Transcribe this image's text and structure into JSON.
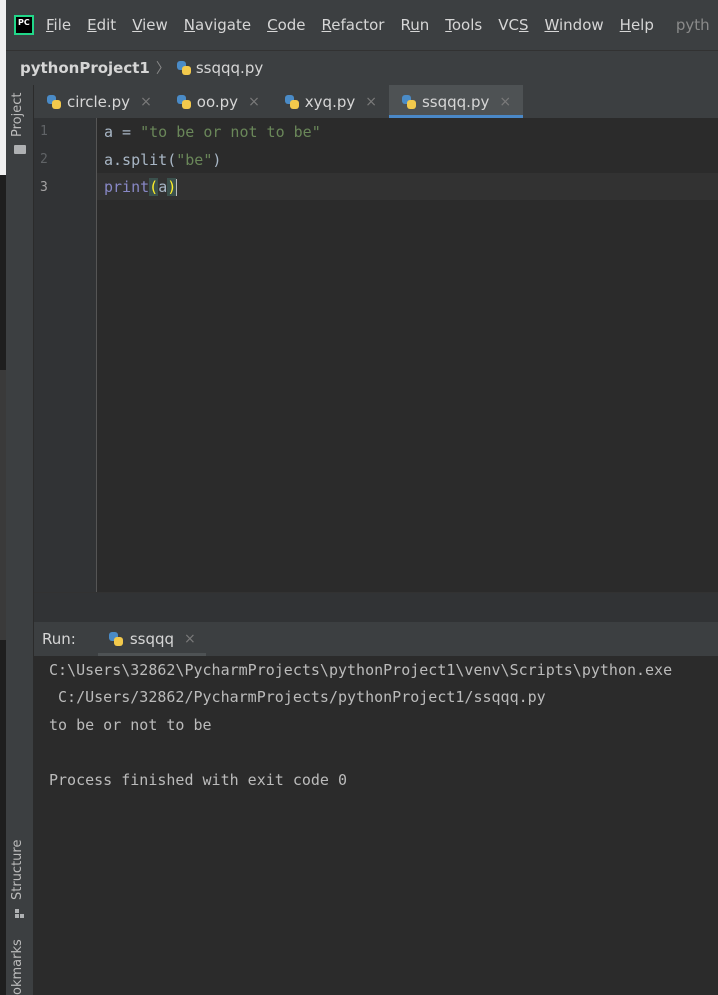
{
  "menubar": {
    "logo_text": "PC",
    "items": [
      {
        "pre": "",
        "ul": "F",
        "post": "ile"
      },
      {
        "pre": "",
        "ul": "E",
        "post": "dit"
      },
      {
        "pre": "",
        "ul": "V",
        "post": "iew"
      },
      {
        "pre": "",
        "ul": "N",
        "post": "avigate"
      },
      {
        "pre": "",
        "ul": "C",
        "post": "ode"
      },
      {
        "pre": "",
        "ul": "R",
        "post": "efactor"
      },
      {
        "pre": "R",
        "ul": "u",
        "post": "n"
      },
      {
        "pre": "",
        "ul": "T",
        "post": "ools"
      },
      {
        "pre": "VC",
        "ul": "S",
        "post": ""
      },
      {
        "pre": "",
        "ul": "W",
        "post": "indow"
      },
      {
        "pre": "",
        "ul": "H",
        "post": "elp"
      }
    ],
    "title_fragment": "pyth"
  },
  "breadcrumb": {
    "project": "pythonProject1",
    "separator": "〉",
    "file": "ssqqq.py"
  },
  "left_stripe": {
    "project_label": "Project",
    "structure_label": "Structure",
    "bookmarks_label": "okmarks"
  },
  "tabs": [
    {
      "label": "circle.py",
      "close": "×"
    },
    {
      "label": "oo.py",
      "close": "×"
    },
    {
      "label": "xyq.py",
      "close": "×"
    },
    {
      "label": "ssqqq.py",
      "close": "×"
    }
  ],
  "editor": {
    "line_numbers": [
      "1",
      "2",
      "3"
    ],
    "lines": {
      "l1_a": "a = ",
      "l1_str": "\"to be or not to be\"",
      "l2_a": "a.split(",
      "l2_str": "\"be\"",
      "l2_b": ")",
      "l3_fn": "print",
      "l3_open": "(",
      "l3_arg": "a",
      "l3_close": ")"
    }
  },
  "run_panel": {
    "label": "Run:",
    "tab": "ssqqq",
    "close": "×"
  },
  "console": {
    "lines": [
      "C:\\Users\\32862\\PycharmProjects\\pythonProject1\\venv\\Scripts\\python.exe",
      " C:/Users/32862/PycharmProjects/pythonProject1/ssqqq.py",
      "to be or not to be",
      "",
      "Process finished with exit code 0"
    ]
  },
  "colors": {
    "accent": "#4a88c7",
    "string": "#6a8759",
    "builtin": "#8888c6",
    "paren_highlight": "#ffef28"
  }
}
